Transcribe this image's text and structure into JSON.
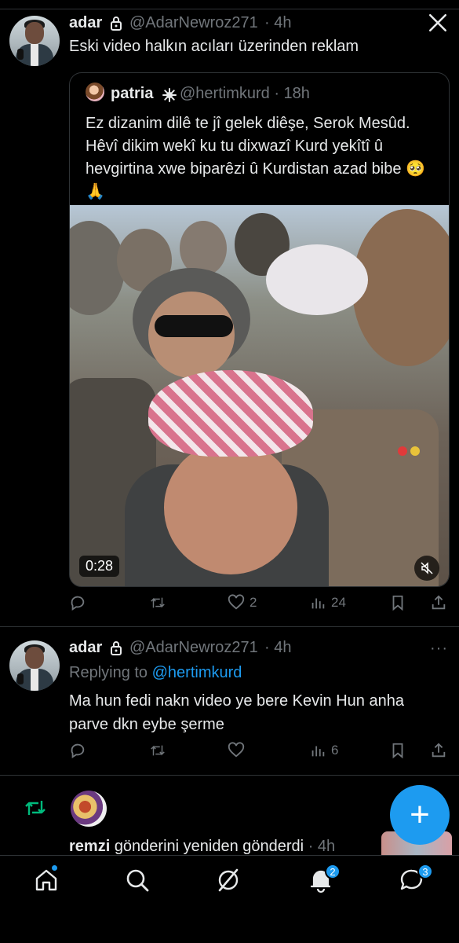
{
  "tweet1": {
    "name": "adar",
    "handle": "@AdarNewroz271",
    "time": "· 4h",
    "text": "Eski video halkın acıları üzerinden reklam",
    "quote": {
      "name": "patria",
      "handle": "@hertimkurd · 18h",
      "text": "Ez dizanim dilê te jî gelek diêşe, Serok Mesûd. Hêvî dikim wekî ku tu dixwazî Kurd yekîtî û hevgirtina xwe biparêzi û Kurdistan azad bibe 🥺🙏",
      "video_duration": "0:28"
    },
    "likes": "2",
    "views": "24"
  },
  "tweet2": {
    "name": "adar",
    "handle": "@AdarNewroz271",
    "time": "· 4h",
    "replying_prefix": "Replying to ",
    "replying_to": "@hertimkurd",
    "text": "Ma hun fedi nakn video ye bere Kevin Hun anha parve dkn eybe şerme",
    "views": "6",
    "more": "···"
  },
  "repost": {
    "user": "remzi",
    "action": "gönderini yeniden gönderdi",
    "time": "· 4h"
  },
  "fab_label": "+",
  "nav": {
    "notifications_badge": "2",
    "messages_badge": "3"
  },
  "colors": {
    "accent": "#1d9bf0",
    "repost_green": "#00ba7c",
    "muted": "#71767b",
    "background": "#000000"
  },
  "icons": [
    "lock-icon",
    "x-logo-icon",
    "verified-badge-icon",
    "reply-icon",
    "retweet-icon",
    "like-icon",
    "views-icon",
    "bookmark-icon",
    "share-icon",
    "mute-icon",
    "home-icon",
    "search-icon",
    "grok-icon",
    "notifications-icon",
    "messages-icon",
    "compose-icon"
  ]
}
